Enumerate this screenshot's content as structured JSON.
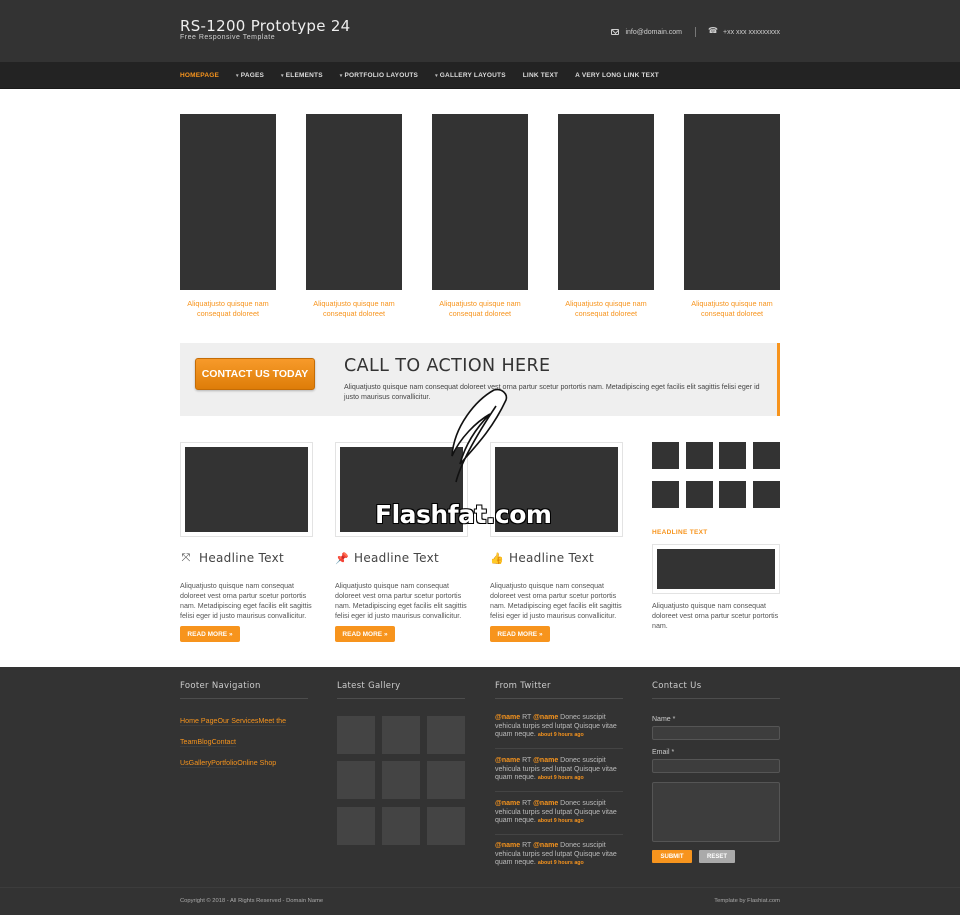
{
  "header": {
    "title": "RS-1200 Prototype 24",
    "subtitle": "Free Responsive Template",
    "email": "info@domain.com",
    "phone": "+xx xxx xxxxxxxxx",
    "mail_icon": "envelope-icon",
    "phone_icon": "phone-icon"
  },
  "nav": {
    "items": [
      {
        "label": "HOMEPAGE",
        "active": true,
        "dropdown": false
      },
      {
        "label": "PAGES",
        "dropdown": true
      },
      {
        "label": "ELEMENTS",
        "dropdown": true
      },
      {
        "label": "PORTFOLIO LAYOUTS",
        "dropdown": true
      },
      {
        "label": "GALLERY LAYOUTS",
        "dropdown": true
      },
      {
        "label": "LINK TEXT",
        "dropdown": false
      },
      {
        "label": "A VERY LONG LINK TEXT",
        "dropdown": false
      }
    ],
    "caret": "▾"
  },
  "portfolio": {
    "items": [
      {
        "caption_1": "Aliquatjusto quisque nam",
        "caption_2": "consequat doloreet"
      },
      {
        "caption_1": "Aliquatjusto quisque nam",
        "caption_2": "consequat doloreet"
      },
      {
        "caption_1": "Aliquatjusto quisque nam",
        "caption_2": "consequat doloreet"
      },
      {
        "caption_1": "Aliquatjusto quisque nam",
        "caption_2": "consequat doloreet"
      },
      {
        "caption_1": "Aliquatjusto quisque nam",
        "caption_2": "consequat doloreet"
      }
    ]
  },
  "cta": {
    "button": "CONTACT US TODAY",
    "title": "CALL TO ACTION HERE",
    "text": "Aliquatjusto quisque nam consequat doloreet vest orna partur scetur portortis nam. Metadipiscing eget facilis elit sagittis felisi eger id justo maurisus convallicitur."
  },
  "features": [
    {
      "icon": "expand-arrows-icon",
      "glyph": "⤧",
      "headline": "Headline Text",
      "text": "Aliquatjusto quisque nam consequat doloreet vest orna partur scetur portortis nam. Metadipiscing eget facilis elit sagittis felisi eger id justo maurisus convallicitur.",
      "button": "READ MORE »"
    },
    {
      "icon": "pushpin-icon",
      "glyph": "📌",
      "headline": "Headline Text",
      "text": "Aliquatjusto quisque nam consequat doloreet vest orna partur scetur portortis nam. Metadipiscing eget facilis elit sagittis felisi eger id justo maurisus convallicitur.",
      "button": "READ MORE »"
    },
    {
      "icon": "thumbs-up-icon",
      "glyph": "👍",
      "headline": "Headline Text",
      "text": "Aliquatjusto quisque nam consequat doloreet vest orna partur scetur portortis nam. Metadipiscing eget facilis elit sagittis felisi eger id justo maurisus convallicitur.",
      "button": "READ MORE »"
    }
  ],
  "sidebar": {
    "headline": "HEADLINE TEXT",
    "text": "Aliquatjusto quisque nam consequat doloreet vest orna partur scetur portortis nam."
  },
  "watermark": {
    "text": "Flashfat.com"
  },
  "footer": {
    "nav_title": "Footer Navigation",
    "nav_items": [
      "Home Page",
      "Our Services",
      "Meet the Team",
      "Blog",
      "Contact Us",
      "Gallery",
      "Portfolio",
      "Online Shop"
    ],
    "gallery_title": "Latest Gallery",
    "twitter_title": "From Twitter",
    "tweets": [
      {
        "at1": "@name",
        "rt": " RT ",
        "at2": "@name",
        "body": " Donec suscipit vehicula turpis sed lutpat Quisque vitae quam neque.",
        "time": "about 9 hours ago"
      },
      {
        "at1": "@name",
        "rt": " RT ",
        "at2": "@name",
        "body": " Donec suscipit vehicula turpis sed lutpat Quisque vitae quam neque.",
        "time": "about 9 hours ago"
      },
      {
        "at1": "@name",
        "rt": " RT ",
        "at2": "@name",
        "body": " Donec suscipit vehicula turpis sed lutpat Quisque vitae quam neque.",
        "time": "about 9 hours ago"
      },
      {
        "at1": "@name",
        "rt": " RT ",
        "at2": "@name",
        "body": " Donec suscipit vehicula turpis sed lutpat Quisque vitae quam neque.",
        "time": "about 9 hours ago"
      }
    ],
    "contact_title": "Contact Us",
    "name_label": "Name *",
    "email_label": "Email *",
    "submit": "SUBMIT",
    "reset": "RESET",
    "copyright": "Copyright © 2018 - All Rights Reserved - Domain Name",
    "credit": "Template by Flashiat.com"
  },
  "colors": {
    "accent": "#f7941d",
    "dark": "#333333",
    "nav_bg": "#232323"
  }
}
